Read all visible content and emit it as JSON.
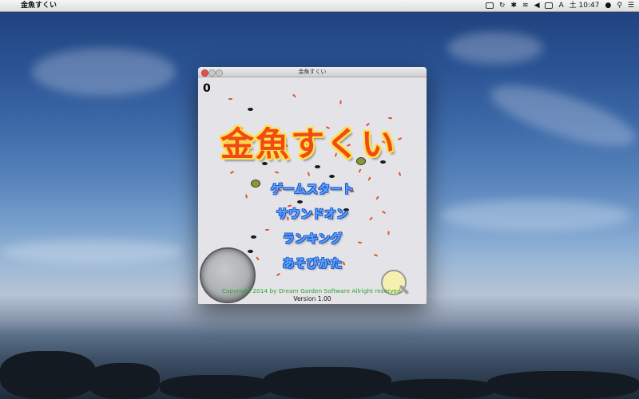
{
  "menubar": {
    "app_name": "金魚すくい",
    "time": "土 10:47",
    "language": "A"
  },
  "window": {
    "title": "金魚すくい"
  },
  "game": {
    "score": "0",
    "logo": "金魚すくい",
    "menu": {
      "start": "ゲームスタート",
      "sound": "サウンドオン",
      "ranking": "ランキング",
      "howto": "あそびかた"
    },
    "copyright": "Copyright 2014 by Dream Garden Software Allright reserved.",
    "version": "Version 1.00"
  },
  "colors": {
    "logo_fill": "#f04a17",
    "logo_outline": "#ffe04a",
    "menu_text": "#5aa8ff",
    "copyright_text": "#2aa52a"
  }
}
